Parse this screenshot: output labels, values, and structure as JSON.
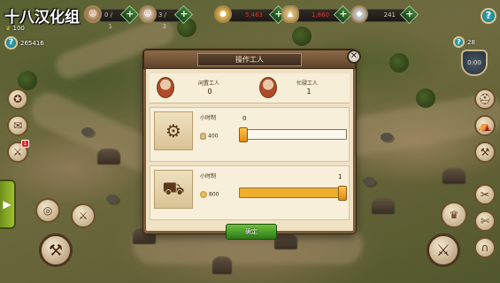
{
  "watermark": "十八汉化组",
  "top_bar": {
    "crown_value": "100",
    "diamond_value": "265416",
    "resources": [
      {
        "icon": "worker-portrait-icon",
        "value": "0 / 1"
      },
      {
        "icon": "worker-portrait-icon",
        "value": "3 / 3"
      },
      {
        "icon": "gold-coin-icon",
        "value": "5,463"
      },
      {
        "icon": "sack-icon",
        "value": "1,860"
      },
      {
        "icon": "stone-icon",
        "value": "241"
      }
    ],
    "plus_label": "+",
    "help_label": "?"
  },
  "right_panel": {
    "stat_value": "28",
    "shield_label": "0:00",
    "help_label": "?"
  },
  "dialog": {
    "title": "操作工人",
    "close_label": "✕",
    "idle_label": "闲置工人",
    "idle_value": "0",
    "busy_label": "忙碌工人",
    "busy_value": "1",
    "cards": [
      {
        "mode": "小时制",
        "cost": "400",
        "slider_value": "0",
        "slider_fraction": 0.0
      },
      {
        "mode": "小时制",
        "cost": "800",
        "slider_value": "1",
        "slider_fraction": 1.0
      }
    ],
    "confirm_label": "确定"
  },
  "left_badge": "1"
}
